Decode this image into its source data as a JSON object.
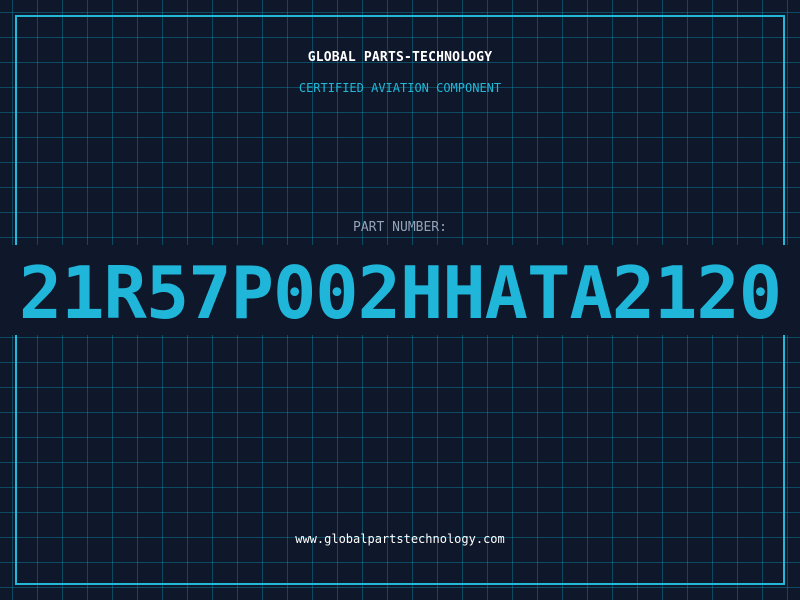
{
  "header": {
    "company_name": "GLOBAL PARTS-TECHNOLOGY",
    "subtitle": "CERTIFIED AVIATION COMPONENT"
  },
  "part": {
    "label": "PART NUMBER:",
    "number": "21R57P002HHATA2120"
  },
  "footer": {
    "website": "www.globalpartstechnology.com"
  },
  "colors": {
    "background": "#0f172a",
    "accent": "#22b8d8",
    "title_text": "#ffffff",
    "label_text": "#94a3b8"
  }
}
